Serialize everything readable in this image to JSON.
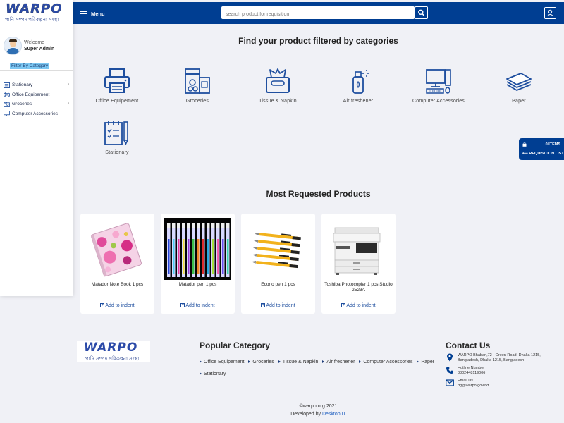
{
  "app": {
    "logo_text": "WARPO",
    "logo_subtitle": "পানি সম্পদ পরিকল্পনা সংস্থা"
  },
  "user": {
    "welcome": "Welcome",
    "name": "Super Admin"
  },
  "sidebar": {
    "filter_label": "Filter By Category",
    "items": [
      {
        "label": "Stationary",
        "icon": "stationary-icon",
        "has_children": true
      },
      {
        "label": "Office Equipement",
        "icon": "printer-icon",
        "has_children": false
      },
      {
        "label": "Groceries",
        "icon": "groceries-icon",
        "has_children": true
      },
      {
        "label": "Computer Accessories",
        "icon": "computer-icon",
        "has_children": false
      }
    ]
  },
  "topbar": {
    "menu_label": "Menu",
    "search_placeholder": "search product for requisition"
  },
  "categories_section": {
    "title": "Find your product filtered by categories",
    "items": [
      {
        "label": "Office Equipement",
        "icon": "printer-icon"
      },
      {
        "label": "Groceries",
        "icon": "groceries-icon"
      },
      {
        "label": "Tissue & Napkin",
        "icon": "tissue-box-icon"
      },
      {
        "label": "Air freshener",
        "icon": "air-freshener-icon"
      },
      {
        "label": "Computer Accessories",
        "icon": "computer-icon"
      },
      {
        "label": "Paper",
        "icon": "paper-stack-icon"
      },
      {
        "label": "Stationary",
        "icon": "stationary-icon"
      }
    ]
  },
  "requisition": {
    "items_count": "0 ITEMS",
    "list_label": "REQUISITION LIST"
  },
  "products_section": {
    "title": "Most Requested Products",
    "add_label": "Add to indent",
    "items": [
      {
        "name": "Matador Note Book 1 pcs",
        "image": "notebook-image"
      },
      {
        "name": "Matador pen 1 pcs",
        "image": "gel-pens-image"
      },
      {
        "name": "Econo pen 1 pcs",
        "image": "ballpoint-pens-image"
      },
      {
        "name": "Toshiba Photocopier 1 pcs Studio 2523A",
        "image": "photocopier-image"
      }
    ]
  },
  "footer": {
    "popular_title": "Popular Category",
    "popular_items": [
      "Office Equipement",
      "Groceries",
      "Tissue & Napkin",
      "Air freshener",
      "Computer Accessories",
      "Paper",
      "Stationary"
    ],
    "contact_title": "Contact Us",
    "address": "WARPO Bhaban,72 - Green Road, Dhaka 1215, Bangladesh, Dhaka-1215, Bangladesh",
    "hotline_label": "Hotline Number",
    "hotline": "8802448119006",
    "email_label": "Email Us",
    "email": "dg@warpo.gov.bd",
    "copyright": "©warpo.org 2021",
    "developed_by": "Developed by",
    "developer": "Desktop IT"
  },
  "colors": {
    "primary": "#003e92",
    "background": "#f0f1f6",
    "accent_icon": "#1f4f9f",
    "filter_highlight": "#7cc7f2"
  }
}
